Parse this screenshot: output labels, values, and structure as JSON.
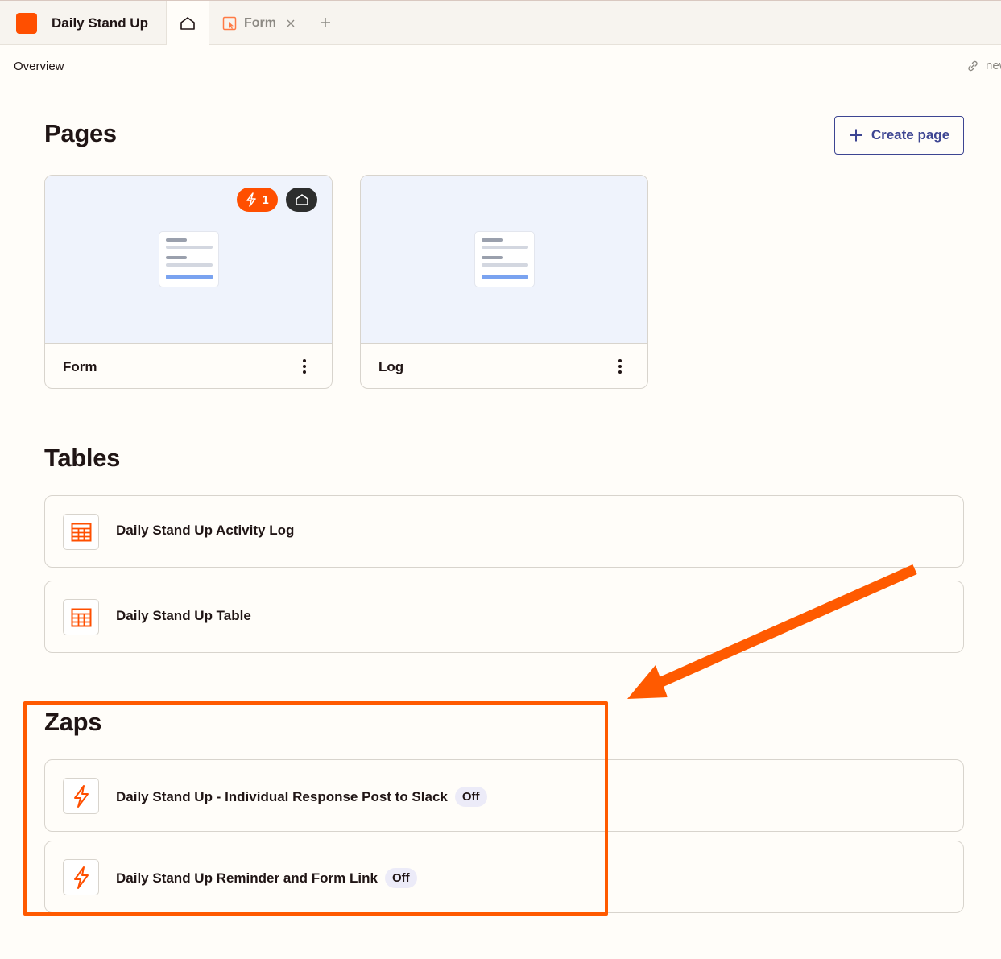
{
  "tabbar": {
    "app_title": "Daily Stand Up",
    "tabs": [
      {
        "label": "Form",
        "icon": "form-page-icon"
      }
    ],
    "new_tab_icon": "plus-icon"
  },
  "subbar": {
    "title": "Overview",
    "link_text": "new"
  },
  "pages": {
    "heading": "Pages",
    "create_label": "Create page",
    "items": [
      {
        "name": "Form",
        "zap_count": "1",
        "is_home": true
      },
      {
        "name": "Log",
        "is_home": false
      }
    ]
  },
  "tables": {
    "heading": "Tables",
    "items": [
      {
        "name": "Daily Stand Up Activity Log"
      },
      {
        "name": "Daily Stand Up Table"
      }
    ]
  },
  "zaps": {
    "heading": "Zaps",
    "items": [
      {
        "name": "Daily Stand Up - Individual Response Post to Slack",
        "status": "Off"
      },
      {
        "name": "Daily Stand Up Reminder and Form Link",
        "status": "Off"
      }
    ]
  },
  "colors": {
    "brand": "#ff4f00",
    "annotation": "#ff5a00",
    "button_text": "#3d4592",
    "thumb_bg": "#eff3fc"
  }
}
